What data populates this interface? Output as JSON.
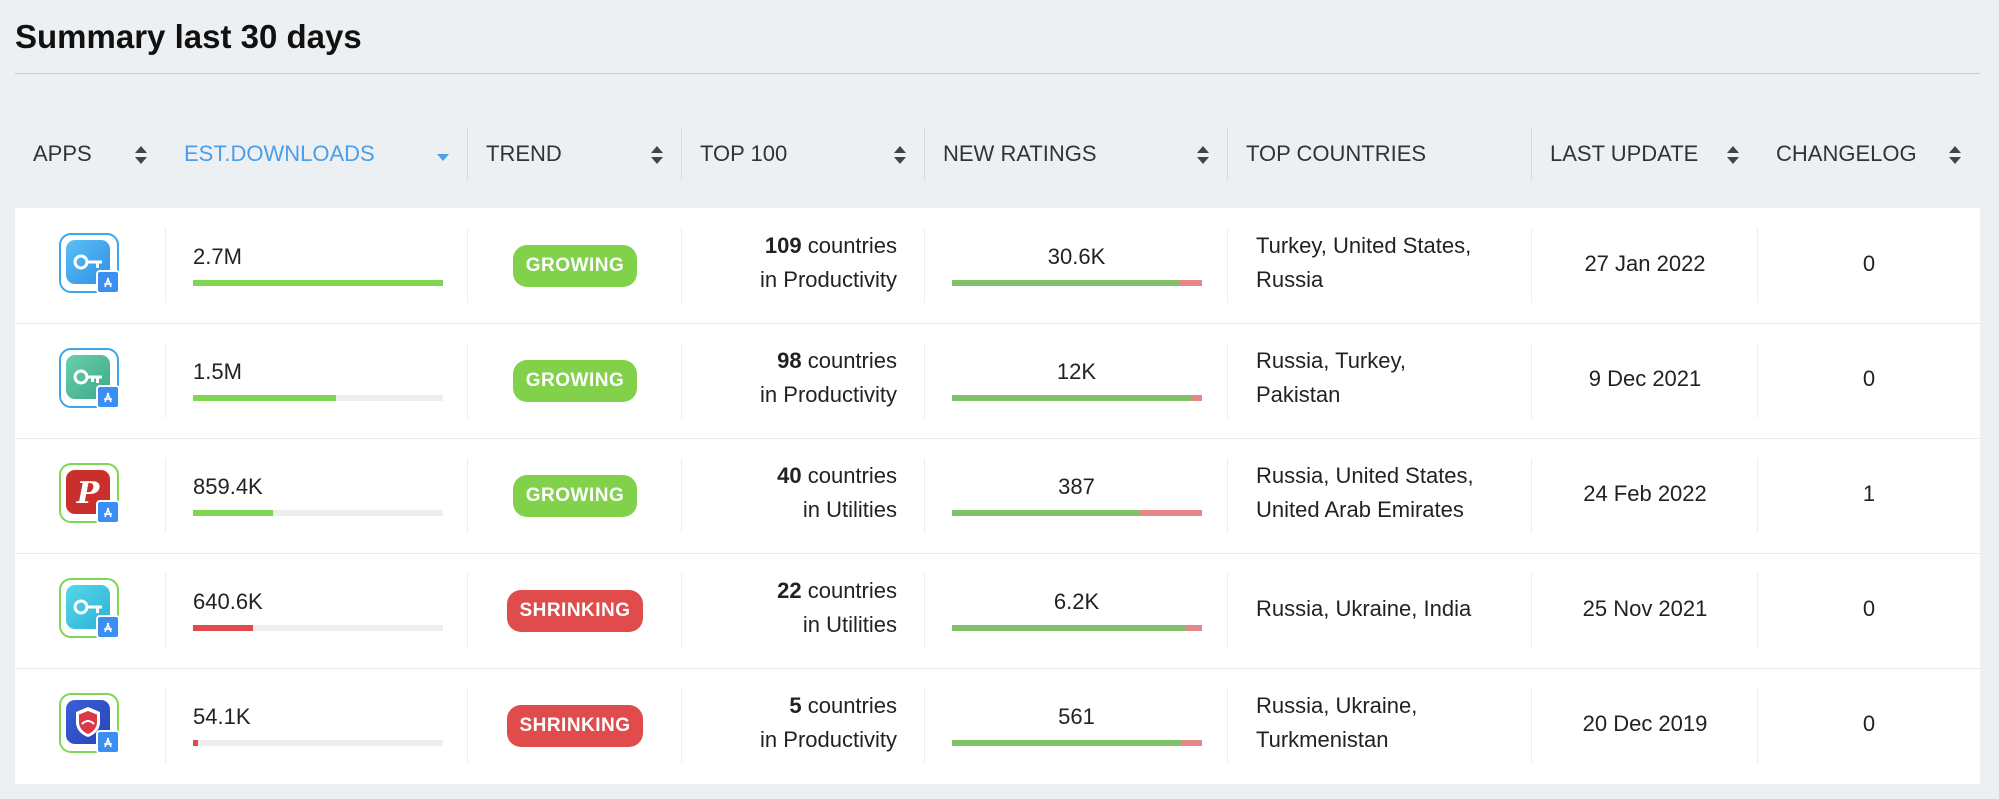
{
  "page": {
    "title": "Summary last 30 days"
  },
  "colors": {
    "accent": "#4a9eea",
    "growing": "#82d14b",
    "shrinking": "#e04b4b",
    "bar_green": "#7fd652",
    "bar_red": "#e04b4b",
    "rating_positive": "#7fc26a",
    "rating_negative": "#e68787"
  },
  "columns": [
    {
      "label": "APPS",
      "sortable": true,
      "active": false
    },
    {
      "label": "EST.DOWNLOADS",
      "sortable": true,
      "active": true,
      "sort": "desc"
    },
    {
      "label": "TREND",
      "sortable": true,
      "active": false
    },
    {
      "label": "TOP 100",
      "sortable": true,
      "active": false
    },
    {
      "label": "NEW RATINGS",
      "sortable": true,
      "active": false
    },
    {
      "label": "TOP COUNTRIES",
      "sortable": false,
      "active": false
    },
    {
      "label": "LAST UPDATE",
      "sortable": true,
      "active": false
    },
    {
      "label": "CHANGELOG",
      "sortable": true,
      "active": false
    }
  ],
  "rows": [
    {
      "icon": "vpn-key-blue-app-icon",
      "downloads": "2.7M",
      "downloads_fraction": 1.0,
      "downloads_trend": "up",
      "trend": "GROWING",
      "top_count": "109",
      "top_suffix": " countries",
      "top_category": "in Productivity",
      "ratings": "30.6K",
      "ratings_positive_fraction": 0.91,
      "countries_line1": "Turkey, United States,",
      "countries_line2": "Russia",
      "last_update": "27 Jan 2022",
      "changelog": "0"
    },
    {
      "icon": "vpn-key-teal-app-icon",
      "downloads": "1.5M",
      "downloads_fraction": 0.57,
      "downloads_trend": "up",
      "trend": "GROWING",
      "top_count": "98",
      "top_suffix": " countries",
      "top_category": "in Productivity",
      "ratings": "12K",
      "ratings_positive_fraction": 0.96,
      "countries_line1": "Russia, Turkey,",
      "countries_line2": "Pakistan",
      "last_update": "9 Dec 2021",
      "changelog": "0"
    },
    {
      "icon": "psiphon-app-icon",
      "downloads": "859.4K",
      "downloads_fraction": 0.32,
      "downloads_trend": "up",
      "trend": "GROWING",
      "top_count": "40",
      "top_suffix": " countries",
      "top_category": "in Utilities",
      "ratings": "387",
      "ratings_positive_fraction": 0.75,
      "countries_line1": "Russia, United States,",
      "countries_line2": "United Arab Emirates",
      "last_update": "24 Feb 2022",
      "changelog": "1"
    },
    {
      "icon": "vpn-key-cyan-app-icon",
      "downloads": "640.6K",
      "downloads_fraction": 0.24,
      "downloads_trend": "down",
      "trend": "SHRINKING",
      "top_count": "22",
      "top_suffix": " countries",
      "top_category": "in Utilities",
      "ratings": "6.2K",
      "ratings_positive_fraction": 0.93,
      "countries_line1": "Russia, Ukraine, India",
      "countries_line2": "",
      "last_update": "25 Nov 2021",
      "changelog": "0"
    },
    {
      "icon": "shield-vpn-app-icon",
      "downloads": "54.1K",
      "downloads_fraction": 0.02,
      "downloads_trend": "down",
      "trend": "SHRINKING",
      "top_count": "5",
      "top_suffix": " countries",
      "top_category": "in Productivity",
      "ratings": "561",
      "ratings_positive_fraction": 0.92,
      "countries_line1": "Russia, Ukraine,",
      "countries_line2": "Turkmenistan",
      "last_update": "20 Dec 2019",
      "changelog": "0"
    }
  ]
}
